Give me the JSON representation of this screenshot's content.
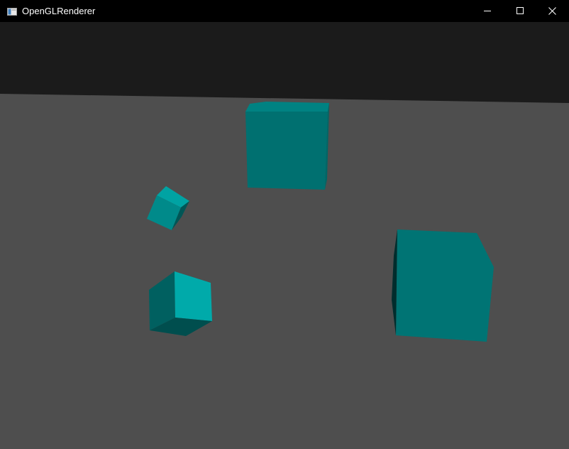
{
  "window": {
    "title": "OpenGLRenderer",
    "icon": "app-window-icon",
    "controls": {
      "minimize_icon": "minimize-icon",
      "maximize_icon": "maximize-icon",
      "close_icon": "close-icon"
    }
  },
  "scene": {
    "sky_color": "#1b1b1b",
    "floor_color": "#4e4e4e",
    "cube_color": "#00aaaa",
    "cube_count": 4
  }
}
